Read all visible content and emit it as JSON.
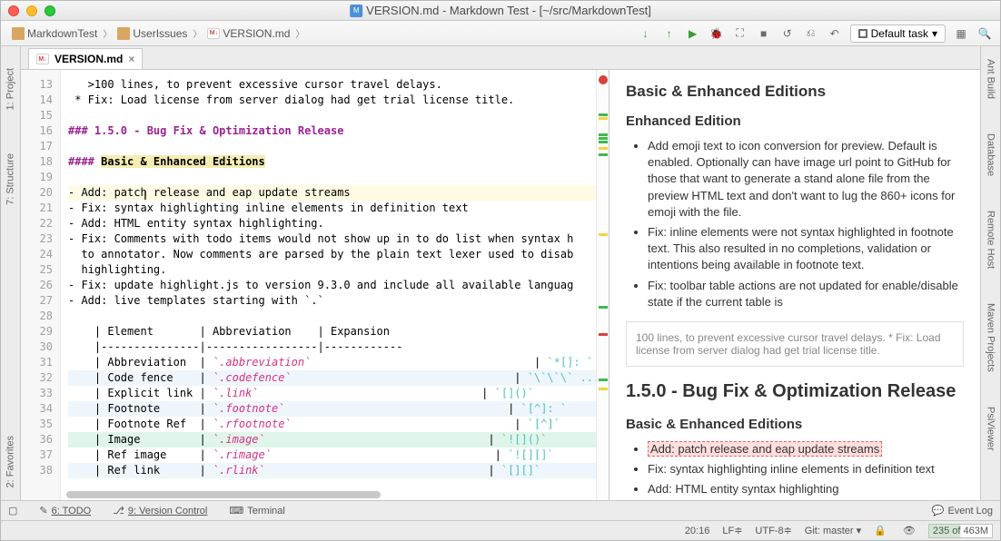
{
  "window_title": "VERSION.md - Markdown Test - [~/src/MarkdownTest]",
  "breadcrumb": {
    "project": "MarkdownTest",
    "folder": "UserIssues",
    "file": "VERSION.md"
  },
  "toolbar": {
    "default_task": "Default task"
  },
  "file_tab": {
    "name": "VERSION.md"
  },
  "left_tabs": {
    "project": "1: Project",
    "structure": "7: Structure",
    "favorites": "2: Favorites"
  },
  "right_tabs": {
    "ant": "Ant Build",
    "database": "Database",
    "remote": "Remote Host",
    "maven": "Maven Projects",
    "psi": "PsiViewer"
  },
  "code": {
    "lines": [
      {
        "n": 13,
        "t": "   >100 lines, to prevent excessive cursor travel delays."
      },
      {
        "n": 14,
        "t": " * Fix: Load license from server dialog had get trial license title."
      },
      {
        "n": 15,
        "t": ""
      },
      {
        "n": 16,
        "t": "### 1.5.0 - Bug Fix & Optimization Release",
        "head": true
      },
      {
        "n": 17,
        "t": ""
      },
      {
        "n": 18,
        "t": "#### Basic & Enhanced Editions",
        "head2": true
      },
      {
        "n": 19,
        "t": ""
      },
      {
        "n": 20,
        "t": "- Add: patch release and eap update streams",
        "cur": true
      },
      {
        "n": 21,
        "t": "- Fix: syntax highlighting inline elements in definition text"
      },
      {
        "n": 22,
        "t": "- Add: HTML entity syntax highlighting."
      },
      {
        "n": 23,
        "t": "- Fix: Comments with todo items would not show up in to do list when syntax h"
      },
      {
        "n": 24,
        "t": "  to annotator. Now comments are parsed by the plain text lexer used to disab"
      },
      {
        "n": 25,
        "t": "  highlighting."
      },
      {
        "n": 26,
        "t": "- Fix: update highlight.js to version 9.3.0 and include all available languag"
      },
      {
        "n": 27,
        "t": "- Add: live templates starting with `.`"
      },
      {
        "n": 28,
        "t": ""
      },
      {
        "n": 29,
        "t": "    | Element       | Abbreviation    | Expansion"
      },
      {
        "n": 30,
        "t": "    |---------------|-----------------|------------"
      },
      {
        "n": 31,
        "tab": [
          "Abbreviation",
          "`.abbreviation`",
          "`*[]: `"
        ]
      },
      {
        "n": 32,
        "tab": [
          "Code fence",
          "`.codefence`",
          "`\\`\\`\\` ... \\`\\`\\``"
        ],
        "bg": "#eef5fb"
      },
      {
        "n": 33,
        "tab": [
          "Explicit link",
          "`.link`",
          "`[]()`"
        ]
      },
      {
        "n": 34,
        "tab": [
          "Footnote",
          "`.footnote`",
          "`[^]: `"
        ],
        "bg": "#eef5fb"
      },
      {
        "n": 35,
        "tab": [
          "Footnote Ref",
          "`.rfootnote`",
          "`[^]`"
        ]
      },
      {
        "n": 36,
        "tab": [
          "Image",
          "`.image`",
          "`![]()`"
        ],
        "bg": "#e0f5ea"
      },
      {
        "n": 37,
        "tab": [
          "Ref image",
          "`.rimage`",
          "`![][]`"
        ]
      },
      {
        "n": 38,
        "tab": [
          "Ref link",
          "`.rlink`",
          "`[][]`"
        ],
        "bg": "#eef5fb"
      }
    ]
  },
  "preview": {
    "h1": "Basic & Enhanced Editions",
    "h2": "Enhanced Edition",
    "list1": [
      "Add emoji text to icon conversion for preview. Default is enabled. Optionally can have image url point to GitHub for those that want to generate a stand alone file from the preview HTML text and don't want to lug the 860+ icons for emoji with the file.",
      "Fix: inline elements were not syntax highlighted in footnote text. This also resulted in no completions, validation or intentions being available in footnote text.",
      "Fix: toolbar table actions are not updated for enable/disable state if the current table is"
    ],
    "quote": "100 lines, to prevent excessive cursor travel delays. * Fix: Load license from server dialog had get trial license title.",
    "h3": "1.5.0 - Bug Fix & Optimization Release",
    "h4": "Basic & Enhanced Editions",
    "list2_highlighted": "Add: patch release and eap update streams",
    "list2": [
      "Fix: syntax highlighting inline elements in definition text",
      "Add: HTML entity syntax highlighting"
    ]
  },
  "bottom": {
    "todo": "6: TODO",
    "vc": "9: Version Control",
    "terminal": "Terminal",
    "eventlog": "Event Log"
  },
  "status": {
    "pos": "20:16",
    "le": "LF",
    "enc": "UTF-8",
    "git": "Git: master",
    "mem": "235 of 463M"
  }
}
